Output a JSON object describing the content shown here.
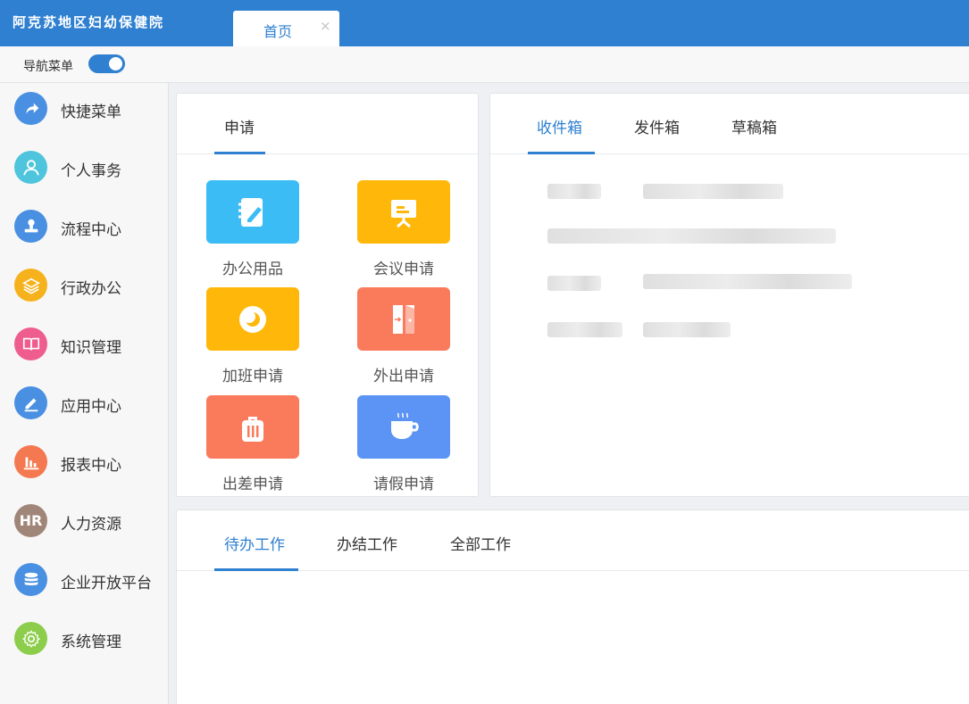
{
  "app": {
    "title": "阿克苏地区妇幼保健院"
  },
  "tabs": [
    {
      "label": "首页",
      "close": "×"
    }
  ],
  "nav_toggle": {
    "label": "导航菜单",
    "on": true
  },
  "sidebar": {
    "items": [
      {
        "label": "快捷菜单",
        "icon": "share-arrow-icon",
        "color": "#4a90e2"
      },
      {
        "label": "个人事务",
        "icon": "person-icon",
        "color": "#4ec5dc"
      },
      {
        "label": "流程中心",
        "icon": "stamp-icon",
        "color": "#4a90e2"
      },
      {
        "label": "行政办公",
        "icon": "layers-icon",
        "color": "#f5b21c"
      },
      {
        "label": "知识管理",
        "icon": "book-icon",
        "color": "#ef5d8e"
      },
      {
        "label": "应用中心",
        "icon": "edit-icon",
        "color": "#4a90e2"
      },
      {
        "label": "报表中心",
        "icon": "bar-chart-icon",
        "color": "#f47850"
      },
      {
        "label": "人力资源",
        "icon": "hr-icon",
        "text": "HR",
        "color": "#a08678"
      },
      {
        "label": "企业开放平台",
        "icon": "database-icon",
        "color": "#4a90e2"
      },
      {
        "label": "系统管理",
        "icon": "gear-icon",
        "color": "#8ccd4b"
      }
    ]
  },
  "apply_panel": {
    "tab": "申请",
    "apps": [
      {
        "label": "办公用品",
        "icon": "notebook-pen-icon",
        "color": "#3bbcf5"
      },
      {
        "label": "会议申请",
        "icon": "presentation-board-icon",
        "color": "#ffb80a"
      },
      {
        "label": "加班申请",
        "icon": "moon-icon",
        "color": "#ffb80a"
      },
      {
        "label": "外出申请",
        "icon": "door-icon",
        "color": "#fa7a5c"
      },
      {
        "label": "出差申请",
        "icon": "luggage-icon",
        "color": "#fa7a5c"
      },
      {
        "label": "请假申请",
        "icon": "coffee-cup-icon",
        "color": "#5b94f4"
      }
    ]
  },
  "mail_panel": {
    "tabs": [
      "收件箱",
      "发件箱",
      "草稿箱"
    ],
    "active_tab": 0
  },
  "work_panel": {
    "tabs": [
      "待办工作",
      "办结工作",
      "全部工作"
    ],
    "active_tab": 0
  },
  "colors": {
    "brand": "#2f80d1"
  }
}
